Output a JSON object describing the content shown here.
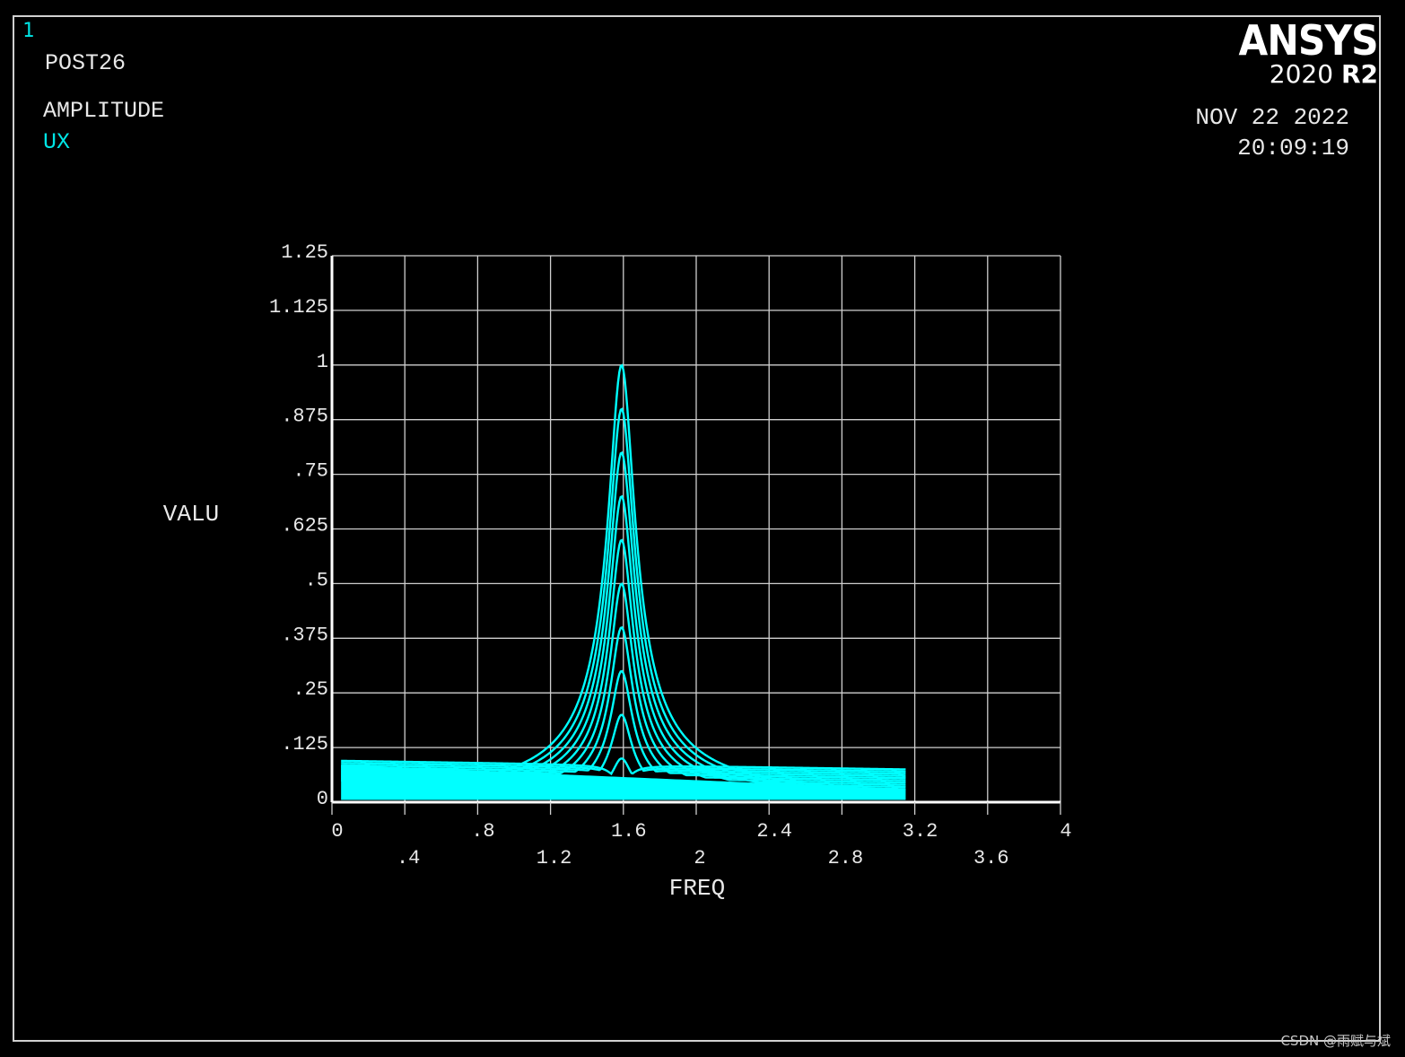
{
  "window": {
    "number": "1",
    "processor": "POST26",
    "quantity": "AMPLITUDE",
    "variable": "UX"
  },
  "branding": {
    "logo": "ANSYS",
    "version_year": "2020",
    "version_release": "R2"
  },
  "stamp": {
    "date": "NOV 22 2022",
    "time": "20:09:19"
  },
  "watermark": "CSDN @雨赋与斌",
  "colors": {
    "background": "#000000",
    "grid": "#cfcfcf",
    "curve": "#00ffff",
    "text": "#e8e8e8",
    "label_accent": "#00e5e5"
  },
  "chart_data": {
    "type": "line",
    "xlabel": "FREQ",
    "ylabel": "VALU",
    "xlim": [
      0,
      4
    ],
    "ylim": [
      0,
      1.25
    ],
    "grid": true,
    "x_ticks_upper": [
      "0",
      ".8",
      "1.6",
      "2.4",
      "3.2",
      "4"
    ],
    "x_ticks_lower": [
      ".4",
      "1.2",
      "2",
      "2.8",
      "3.6"
    ],
    "x_tick_values_upper": [
      0,
      0.8,
      1.6,
      2.4,
      3.2,
      4.0
    ],
    "x_tick_values_lower": [
      0.4,
      1.2,
      2.0,
      2.8,
      3.6
    ],
    "y_ticks": [
      "0",
      ".125",
      ".25",
      ".375",
      ".5",
      ".625",
      ".75",
      ".875",
      "1",
      "1.125",
      "1.25"
    ],
    "y_tick_values": [
      0,
      0.125,
      0.25,
      0.375,
      0.5,
      0.625,
      0.75,
      0.875,
      1.0,
      1.125,
      1.25
    ],
    "x_range_plotted": [
      0.05,
      3.15
    ],
    "resonance_frequency": 1.59,
    "peak_values": [
      0.1,
      0.2,
      0.3,
      0.4,
      0.5,
      0.6,
      0.7,
      0.8,
      0.9,
      1.0
    ],
    "curve_count": 10
  }
}
